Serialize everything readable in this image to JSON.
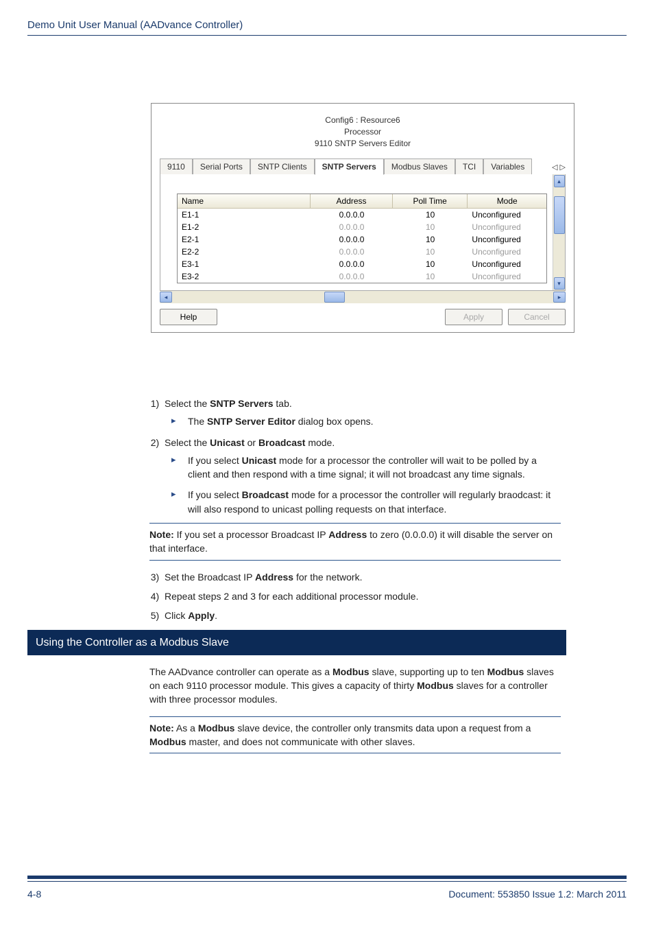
{
  "header": {
    "title": "Demo Unit User Manual  (AADvance Controller)"
  },
  "dialog": {
    "title_l1": "Config6 : Resource6",
    "title_l2": "Processor",
    "title_l3": "9110 SNTP Servers Editor",
    "tabs": [
      "9110",
      "Serial Ports",
      "SNTP Clients",
      "SNTP Servers",
      "Modbus Slaves",
      "TCI",
      "Variables"
    ],
    "active_tab_index": 3,
    "table": {
      "headers": [
        "Name",
        "Address",
        "Poll Time",
        "Mode"
      ],
      "rows": [
        {
          "name": "E1-1",
          "address": "0.0.0.0",
          "poll": "10",
          "mode": "Unconfigured",
          "disabled": false
        },
        {
          "name": "E1-2",
          "address": "0.0.0.0",
          "poll": "10",
          "mode": "Unconfigured",
          "disabled": true
        },
        {
          "name": "E2-1",
          "address": "0.0.0.0",
          "poll": "10",
          "mode": "Unconfigured",
          "disabled": false
        },
        {
          "name": "E2-2",
          "address": "0.0.0.0",
          "poll": "10",
          "mode": "Unconfigured",
          "disabled": true
        },
        {
          "name": "E3-1",
          "address": "0.0.0.0",
          "poll": "10",
          "mode": "Unconfigured",
          "disabled": false
        },
        {
          "name": "E3-2",
          "address": "0.0.0.0",
          "poll": "10",
          "mode": "Unconfigured",
          "disabled": true
        }
      ]
    },
    "buttons": {
      "help": "Help",
      "apply": "Apply",
      "cancel": "Cancel"
    }
  },
  "steps": {
    "s1": "Select the ",
    "s1b": "SNTP Servers",
    "s1c": " tab.",
    "s1_sub": "The ",
    "s1_subb": "SNTP Server Editor",
    "s1_subc": " dialog box opens.",
    "s2": "Select the ",
    "s2b1": "Unicast",
    "s2mid": " or ",
    "s2b2": "Broadcast",
    "s2c": " mode.",
    "s2_sub1a": "If you select ",
    "s2_sub1b": "Unicast",
    "s2_sub1c": " mode for a processor the controller will wait to be polled by a client and then respond with a time signal; it will not broadcast any time signals.",
    "s2_sub2a": "If you select ",
    "s2_sub2b": "Broadcast",
    "s2_sub2c": " mode for a processor the controller will regularly braodcast: it will also respond to unicast polling requests on that interface.",
    "note1a": "Note:",
    "note1b": " If you set a processor Broadcast IP ",
    "note1c": "Address",
    "note1d": " to zero (0.0.0.0) it will disable the server on that interface.",
    "s3a": "Set the Broadcast IP ",
    "s3b": "Address",
    "s3c": " for the network.",
    "s4": "Repeat steps 2 and 3 for each additional processor module.",
    "s5a": "Click ",
    "s5b": "Apply",
    "s5c": "."
  },
  "section": {
    "title": "Using the Controller as a Modbus Slave"
  },
  "para1": {
    "t1": "The AADvance controller can operate as a ",
    "b1": "Modbus",
    "t2": " slave, supporting up to ten ",
    "b2": "Modbus",
    "t3": " slaves on each 9110 processor module. This gives a capacity of thirty ",
    "b3": "Modbus",
    "t4": " slaves for a controller with three processor modules."
  },
  "note2": {
    "b1": "Note:",
    "t1": " As a ",
    "b2": "Modbus",
    "t2": " slave device, the controller only transmits data upon a request from a ",
    "b3": "Modbus",
    "t3": " master, and does not communicate with other slaves."
  },
  "footer": {
    "left": "4-8",
    "right": "Document: 553850 Issue 1.2: March 2011"
  }
}
